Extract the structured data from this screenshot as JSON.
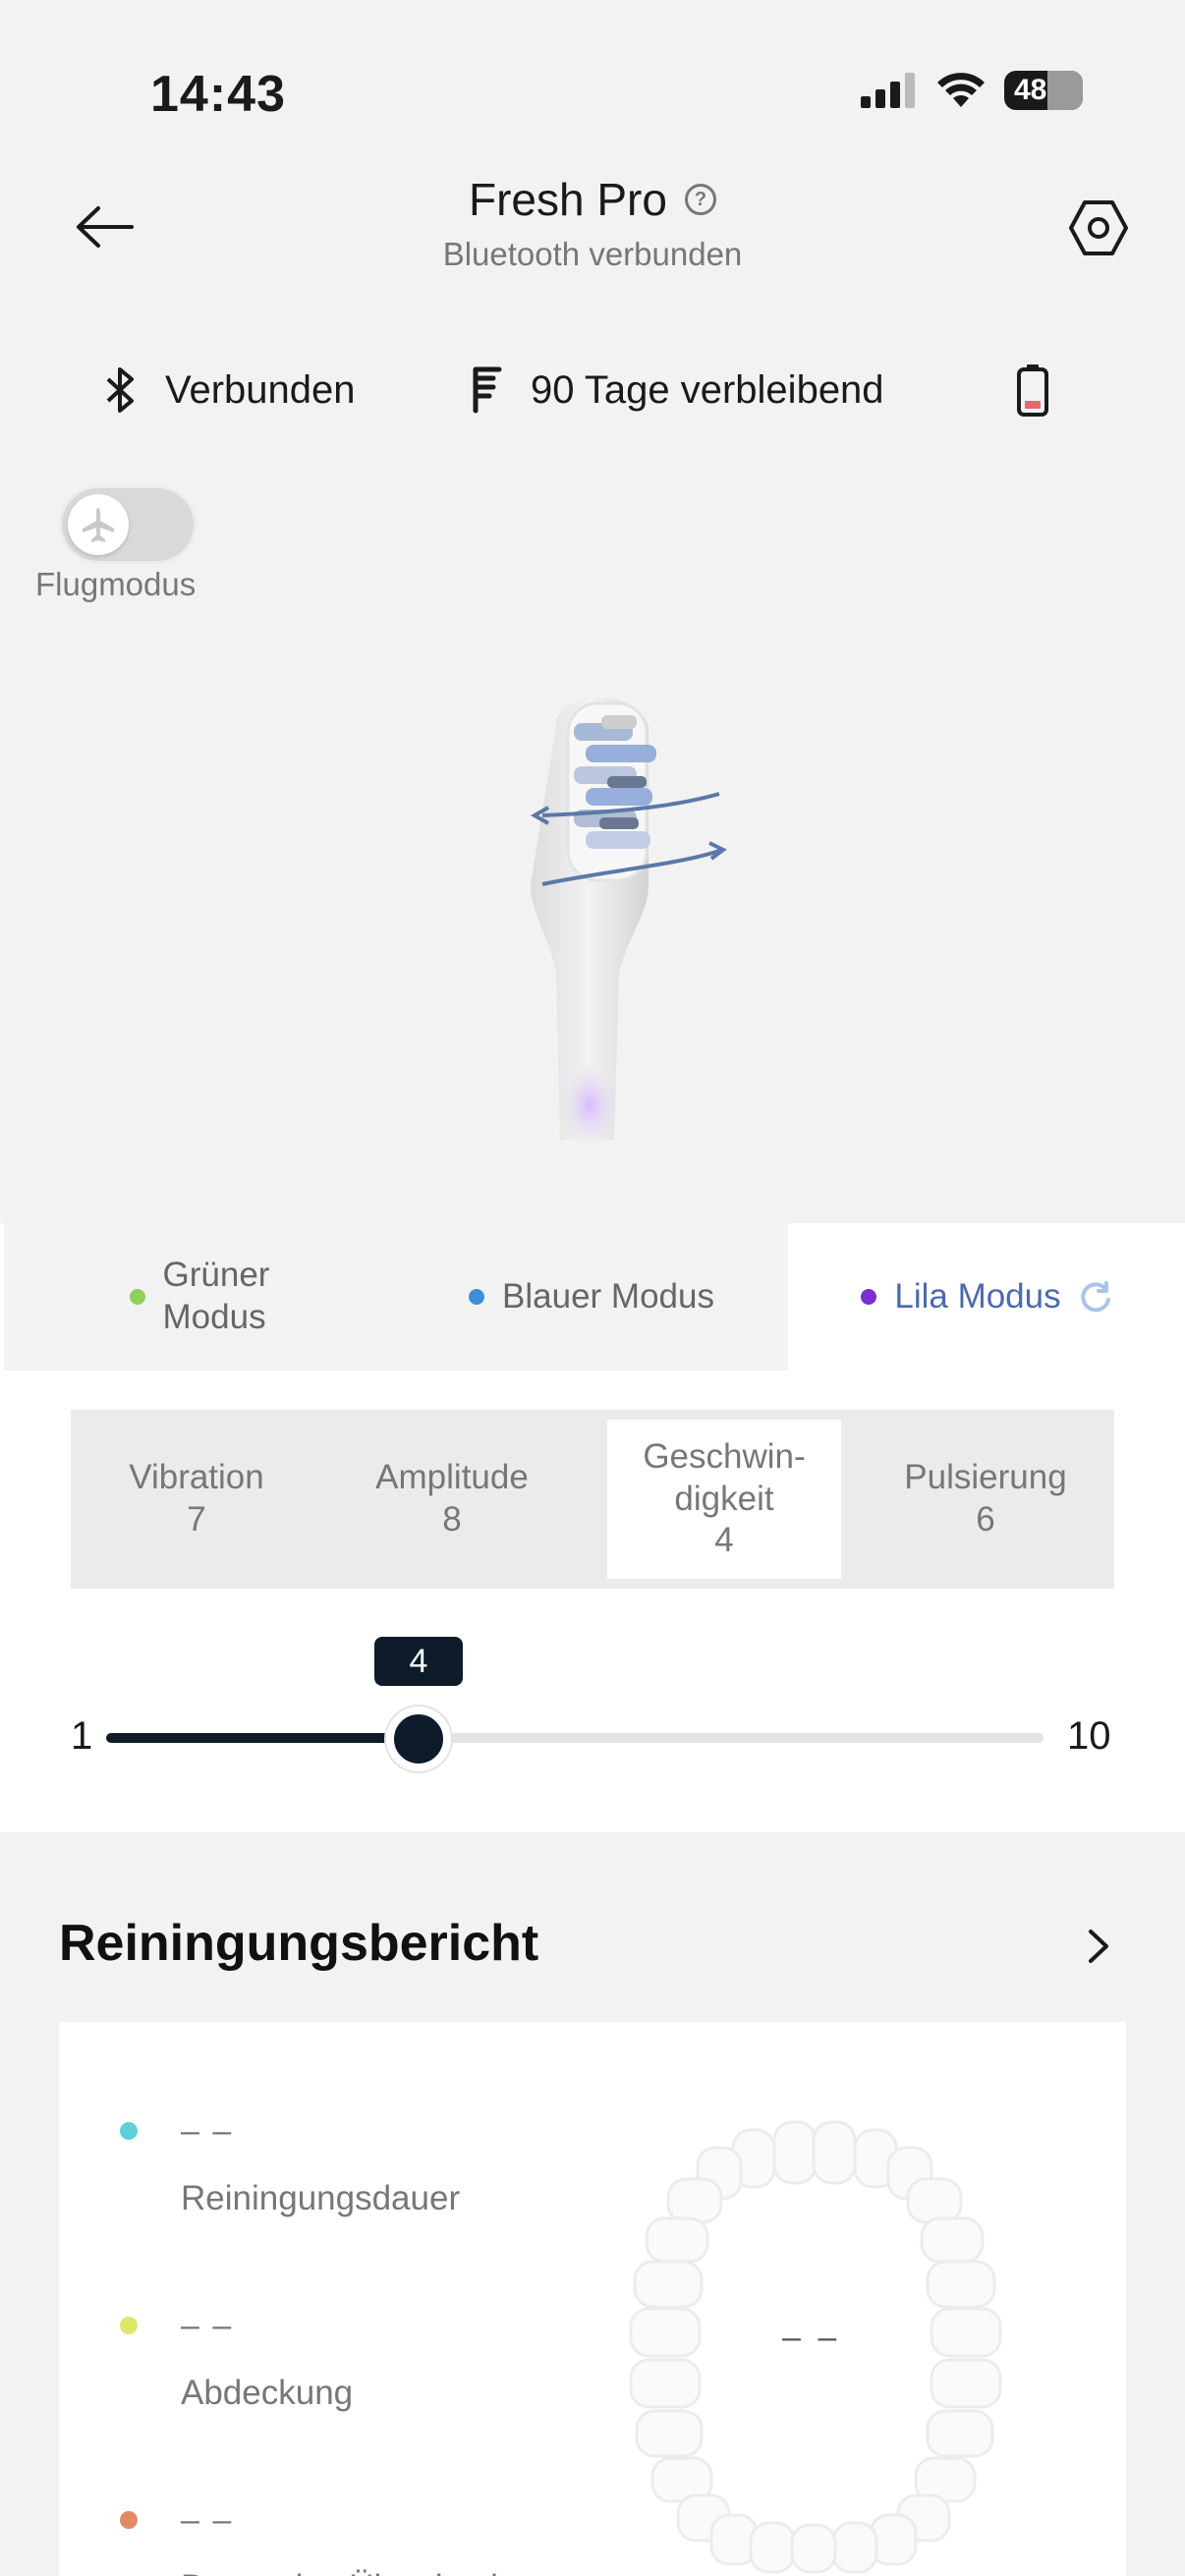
{
  "status_bar": {
    "time": "14:43",
    "battery": "48",
    "battery_pct": 48
  },
  "header": {
    "title": "Fresh Pro",
    "subtitle": "Bluetooth verbunden",
    "help_icon": "question-circle-icon"
  },
  "info_row": {
    "connection": "Verbunden",
    "brush_head": "90 Tage verbleibend"
  },
  "flight_mode": {
    "label": "Flugmodus",
    "enabled": false
  },
  "modes": [
    {
      "label": "Grüner\nModus",
      "color": "#8ed05a",
      "active": false
    },
    {
      "label": "Blauer Modus",
      "color": "#3b8fd9",
      "active": false
    },
    {
      "label": "Lila Modus",
      "color": "#7a2fd0",
      "active": true
    }
  ],
  "params": [
    {
      "label": "Vibration",
      "value": "7"
    },
    {
      "label": "Amplitude",
      "value": "8"
    },
    {
      "label": "Geschwin-\ndigkeit",
      "value": "4",
      "active": true
    },
    {
      "label": "Pulsierung",
      "value": "6"
    }
  ],
  "slider": {
    "min": "1",
    "max": "10",
    "value": "4",
    "value_num": 4,
    "min_num": 1,
    "max_num": 10
  },
  "report": {
    "title": "Reiningungsbericht",
    "metrics": [
      {
        "value": "– –",
        "label": "Reiningungsdauer",
        "color": "#5ed0d8"
      },
      {
        "value": "– –",
        "label": "Abdeckung",
        "color": "#dde86a"
      },
      {
        "value": "– –",
        "label": "Dauer des Überdrucks",
        "color": "#e08a64"
      }
    ],
    "center_value": "– –"
  },
  "colors": {
    "accent_dark": "#0d1b2a",
    "active_mode_text": "#4a6ab0"
  }
}
